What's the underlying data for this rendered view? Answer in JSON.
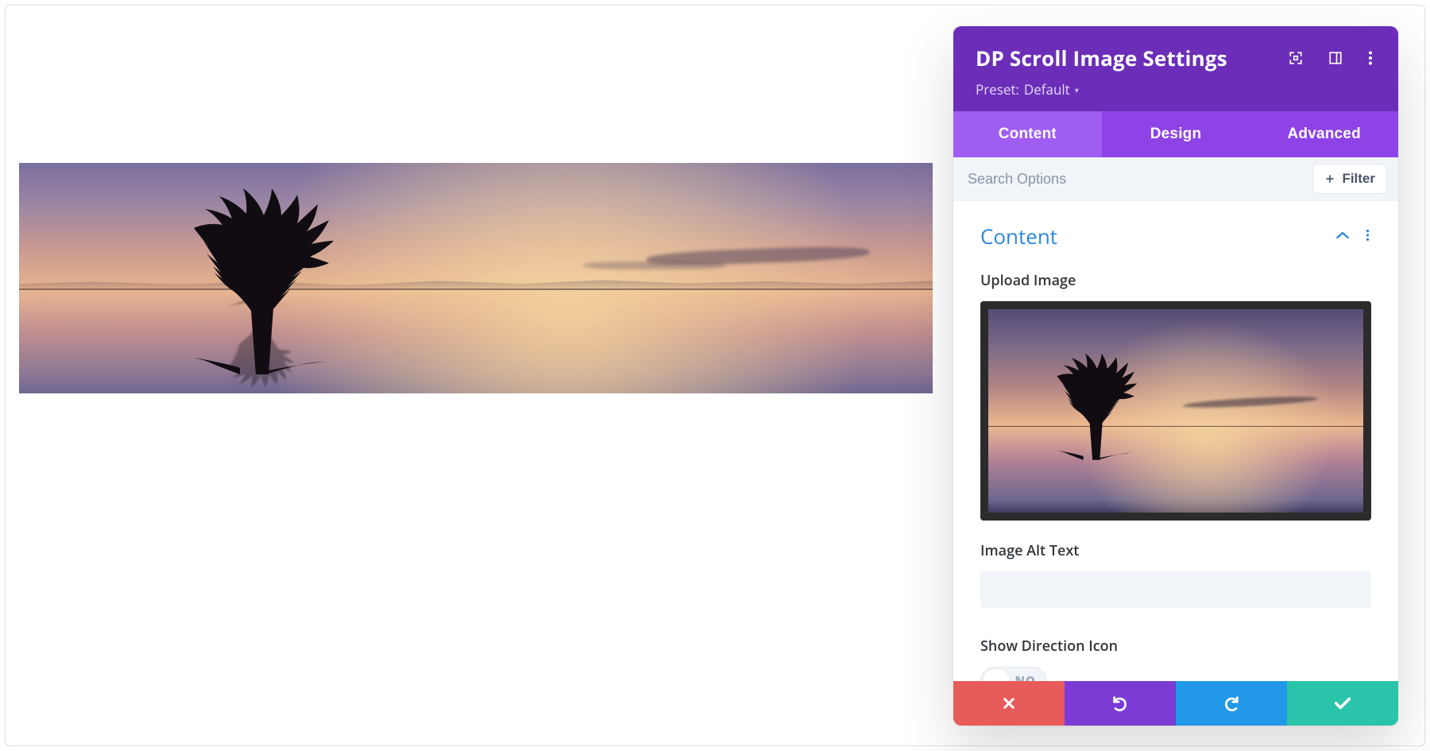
{
  "panel": {
    "title": "DP Scroll Image Settings",
    "preset_label": "Preset:",
    "preset_value": "Default"
  },
  "tabs": {
    "content": "Content",
    "design": "Design",
    "advanced": "Advanced",
    "active": "content"
  },
  "search": {
    "placeholder": "Search Options",
    "filter_label": "Filter"
  },
  "section": {
    "title": "Content"
  },
  "fields": {
    "upload_label": "Upload Image",
    "alt_label": "Image Alt Text",
    "alt_value": "",
    "direction_label": "Show Direction Icon",
    "direction_state": "NO"
  },
  "icons": {
    "fullscreen": "fullscreen-icon",
    "sidebar": "sidebar-layout-icon",
    "more": "more-vertical-icon",
    "plus": "plus-icon",
    "chevron_up": "chevron-up-icon",
    "undo": "undo-icon",
    "redo": "redo-icon",
    "check": "check-icon",
    "close": "close-icon"
  },
  "colors": {
    "header": "#6c2eb9",
    "tabs_bg": "#8e43e7",
    "tab_active": "#a05df1",
    "link": "#2b87da",
    "cancel": "#e85b5b",
    "undo": "#7c3bd4",
    "redo": "#2199e8",
    "save": "#29c4a9"
  }
}
